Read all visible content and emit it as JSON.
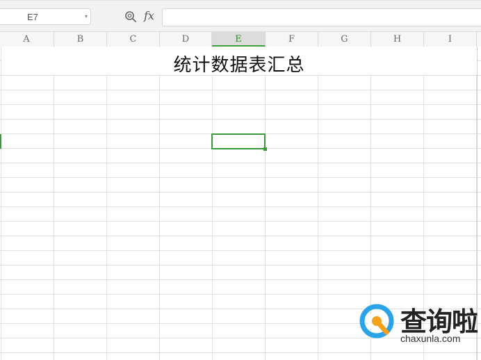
{
  "formula_bar": {
    "name_box_value": "E7",
    "zoom_icon": "zoom-search-icon",
    "fx_label": "fx",
    "formula_value": ""
  },
  "columns": [
    "A",
    "B",
    "C",
    "D",
    "E",
    "F",
    "G",
    "H",
    "I"
  ],
  "active_column": "E",
  "sheet": {
    "title": "统计数据表汇总",
    "selected_cell": "E7"
  },
  "watermark": {
    "brand_cn": "查询啦",
    "url": "chaxunla.com",
    "logo_icon": "magnifier-q-logo-icon"
  },
  "colors": {
    "selection": "#3a9a3a",
    "watermark_blue": "#2aa3e8",
    "watermark_orange": "#f4a21a"
  }
}
